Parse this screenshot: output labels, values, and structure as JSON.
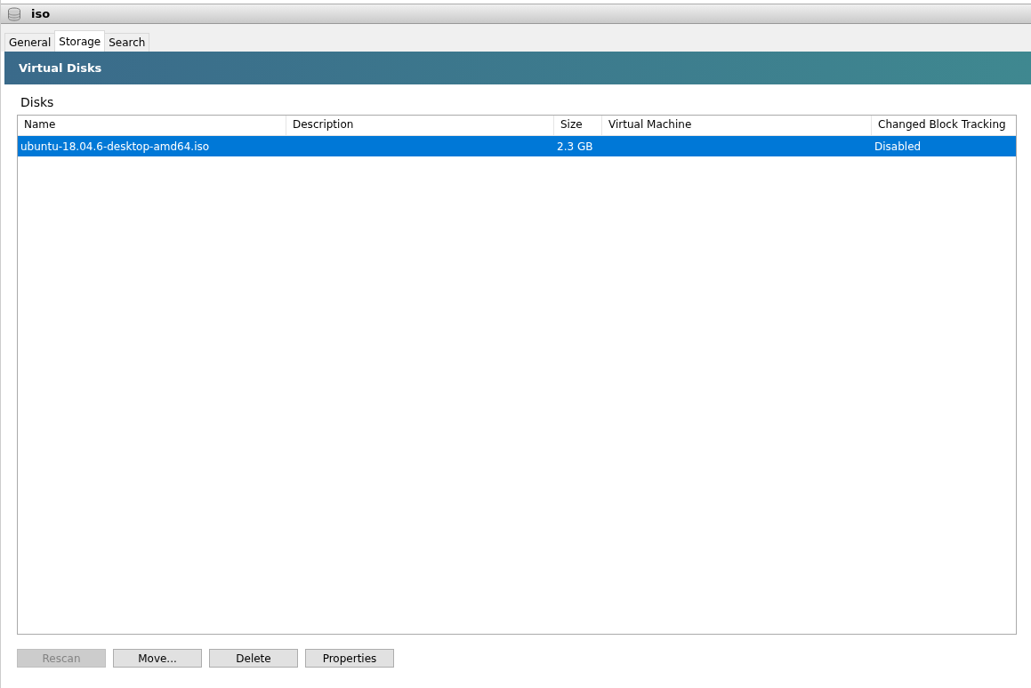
{
  "window": {
    "title": "iso"
  },
  "tabs": [
    {
      "label": "General",
      "selected": false
    },
    {
      "label": "Storage",
      "selected": true
    },
    {
      "label": "Search",
      "selected": false
    }
  ],
  "banner": {
    "title": "Virtual Disks"
  },
  "disks": {
    "heading": "Disks",
    "columns": [
      "Name",
      "Description",
      "Size",
      "Virtual Machine",
      "Changed Block Tracking"
    ],
    "rows": [
      {
        "cells": [
          "ubuntu-18.04.6-desktop-amd64.iso",
          "",
          "2.3 GB",
          "",
          "Disabled"
        ],
        "selected": true
      }
    ]
  },
  "buttons": [
    {
      "label": "Rescan",
      "disabled": true
    },
    {
      "label": "Move...",
      "disabled": false
    },
    {
      "label": "Delete",
      "disabled": false
    },
    {
      "label": "Properties",
      "disabled": false
    }
  ]
}
